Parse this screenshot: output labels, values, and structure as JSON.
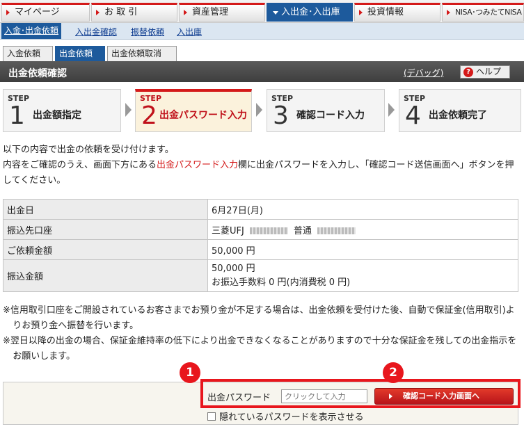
{
  "topnav": [
    {
      "label": "マイページ"
    },
    {
      "label": "お 取 引"
    },
    {
      "label": "資産管理"
    },
    {
      "label": "入出金･入出庫"
    },
    {
      "label": "投資情報"
    },
    {
      "label": "NISA･つみたてNISA"
    }
  ],
  "subnav": [
    {
      "label": "入金･出金依頼"
    },
    {
      "label": "入出金確認"
    },
    {
      "label": "振替依頼"
    },
    {
      "label": "入出庫"
    }
  ],
  "subtabs": [
    {
      "label": "入金依頼"
    },
    {
      "label": "出金依頼"
    },
    {
      "label": "出金依頼取消"
    }
  ],
  "titlebar": {
    "title": "出金依頼確認",
    "debug": "(デバッグ)",
    "help": "ヘルプ",
    "help_icon": "?"
  },
  "steps": [
    {
      "label": "STEP",
      "num": "1",
      "name": "出金額指定"
    },
    {
      "label": "STEP",
      "num": "2",
      "name": "出金パスワード入力"
    },
    {
      "label": "STEP",
      "num": "3",
      "name": "確認コード入力"
    },
    {
      "label": "STEP",
      "num": "4",
      "name": "出金依頼完了"
    }
  ],
  "intro": {
    "line1": "以下の内容で出金の依頼を受け付けます。",
    "line2a": "内容をご確認のうえ、画面下方にある",
    "line2hl": "出金パスワード入力",
    "line2b": "欄に出金パスワードを入力し、「確認コード送信画面へ」ボタンを押してください。"
  },
  "table": {
    "date_label": "出金日",
    "date_value": "6月27日(月)",
    "account_label": "振込先口座",
    "bank": "三菱UFJ",
    "account_type": "普通",
    "request_label": "ご依頼金額",
    "request_value": "50,000 円",
    "transfer_label": "振込金額",
    "transfer_value": "50,000 円",
    "fee": "お振込手数料 0 円(内消費税 0 円)"
  },
  "notes": [
    "※信用取引口座をご開設されているお客さまでお預り金が不足する場合は、出金依頼を受付けた後、自動で保証金(信用取引)よりお預り金へ振替を行います。",
    "※翌日以降の出金の場合、保証金維持率の低下により出金できなくなることがありますので十分な保証金を残しての出金指示をお願いします。"
  ],
  "form": {
    "pw_label": "出金パスワード",
    "pw_placeholder": "クリックして入力",
    "submit": "確認コード入力画面へ",
    "show_pw": "隠れているパスワードを表示させる"
  },
  "badges": [
    "1",
    "2"
  ],
  "colors": {
    "accent_red": "#d41a1a",
    "nav_blue": "#1d5a9c",
    "highlight": "#e8161d"
  }
}
